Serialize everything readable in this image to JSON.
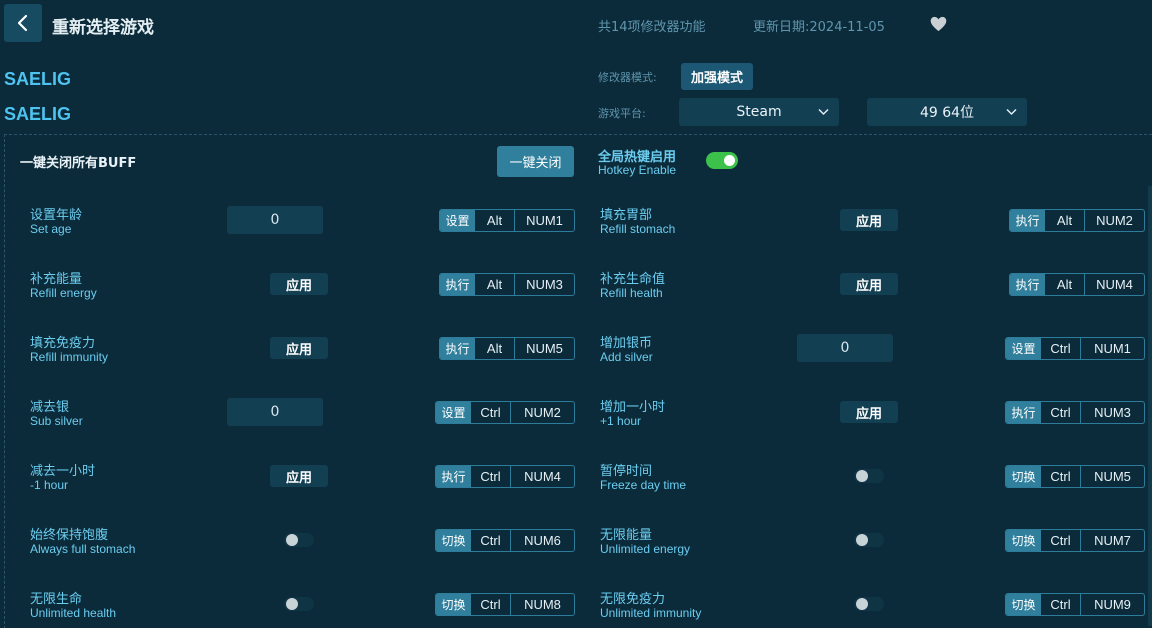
{
  "header": {
    "title": "重新选择游戏",
    "trainer_count": "共14项修改器功能",
    "update_date": "更新日期:2024-11-05"
  },
  "game": {
    "name_line1": "SAELIG",
    "name_line2": "SAELIG"
  },
  "settings": {
    "mode_label": "修改器模式:",
    "mode_value": "加强模式",
    "platform_label": "游戏平台:",
    "platform_value": "Steam",
    "bits_value": "49 64位"
  },
  "controls": {
    "close_all_label": "一键关闭所有BUFF",
    "close_all_button": "一键关闭",
    "hotkey_cn": "全局热键启用",
    "hotkey_en": "Hotkey Enable",
    "hotkey_enabled": true
  },
  "features": [
    {
      "cn": "设置年龄",
      "en": "Set age",
      "control": "input",
      "value": "0",
      "action": "设置",
      "mod": "Alt",
      "key": "NUM1"
    },
    {
      "cn": "填充胃部",
      "en": "Refill stomach",
      "control": "apply",
      "label": "应用",
      "action": "执行",
      "mod": "Alt",
      "key": "NUM2"
    },
    {
      "cn": "补充能量",
      "en": "Refill energy",
      "control": "apply",
      "label": "应用",
      "action": "执行",
      "mod": "Alt",
      "key": "NUM3"
    },
    {
      "cn": "补充生命值",
      "en": "Refill health",
      "control": "apply",
      "label": "应用",
      "action": "执行",
      "mod": "Alt",
      "key": "NUM4"
    },
    {
      "cn": "填充免疫力",
      "en": "Refill immunity",
      "control": "apply",
      "label": "应用",
      "action": "执行",
      "mod": "Alt",
      "key": "NUM5"
    },
    {
      "cn": "增加银币",
      "en": "Add silver",
      "control": "input",
      "value": "0",
      "action": "设置",
      "mod": "Ctrl",
      "key": "NUM1"
    },
    {
      "cn": "减去银",
      "en": "Sub silver",
      "control": "input",
      "value": "0",
      "action": "设置",
      "mod": "Ctrl",
      "key": "NUM2"
    },
    {
      "cn": "增加一小时",
      "en": "+1 hour",
      "control": "apply",
      "label": "应用",
      "action": "执行",
      "mod": "Ctrl",
      "key": "NUM3"
    },
    {
      "cn": "减去一小时",
      "en": "-1 hour",
      "control": "apply",
      "label": "应用",
      "action": "执行",
      "mod": "Ctrl",
      "key": "NUM4"
    },
    {
      "cn": "暂停时间",
      "en": "Freeze day time",
      "control": "toggle",
      "action": "切换",
      "mod": "Ctrl",
      "key": "NUM5"
    },
    {
      "cn": "始终保持饱腹",
      "en": "Always full stomach",
      "control": "toggle",
      "action": "切换",
      "mod": "Ctrl",
      "key": "NUM6"
    },
    {
      "cn": "无限能量",
      "en": "Unlimited energy",
      "control": "toggle",
      "action": "切换",
      "mod": "Ctrl",
      "key": "NUM7"
    },
    {
      "cn": "无限生命",
      "en": "Unlimited health",
      "control": "toggle",
      "action": "切换",
      "mod": "Ctrl",
      "key": "NUM8"
    },
    {
      "cn": "无限免疫力",
      "en": "Unlimited immunity",
      "control": "toggle",
      "action": "切换",
      "mod": "Ctrl",
      "key": "NUM9"
    }
  ],
  "icons": {
    "back": "chevron-left-icon",
    "favorite": "heart-icon",
    "dropdown": "chevron-down-icon"
  },
  "colors": {
    "background": "#0b2b3a",
    "accent": "#2f7f9d",
    "label": "#6bcdf0",
    "game_name": "#4ec3ef",
    "toggle_on": "#3cc24a"
  }
}
